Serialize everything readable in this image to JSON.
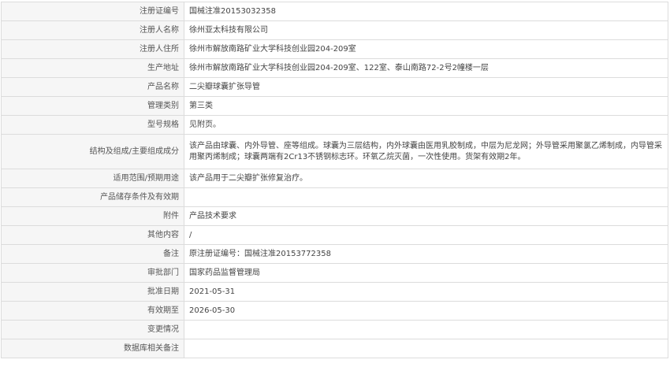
{
  "rows": [
    {
      "label": "注册证编号",
      "value": "国械注准20153032358"
    },
    {
      "label": "注册人名称",
      "value": "徐州亚太科技有限公司"
    },
    {
      "label": "注册人住所",
      "value": "徐州市解放南路矿业大学科技创业园204-209室"
    },
    {
      "label": "生产地址",
      "value": "徐州市解放南路矿业大学科技创业园204-209室、122室、泰山南路72-2号2幢楼一层"
    },
    {
      "label": "产品名称",
      "value": "二尖瓣球囊扩张导管"
    },
    {
      "label": "管理类别",
      "value": "第三类"
    },
    {
      "label": "型号规格",
      "value": "见附页。"
    },
    {
      "label": "结构及组成/主要组成成分",
      "value": "该产品由球囊、内外导管、座等组成。球囊为三层结构，内外球囊由医用乳胶制成，中层为尼龙网；外导管采用聚氯乙烯制成，内导管采用聚丙烯制成；球囊两端有2Cr13不锈钢标志环。环氧乙烷灭菌，一次性使用。货架有效期2年。"
    },
    {
      "label": "适用范围/预期用途",
      "value": "该产品用于二尖瓣扩张修复治疗。"
    },
    {
      "label": "产品储存条件及有效期",
      "value": ""
    },
    {
      "label": "附件",
      "value": "产品技术要求"
    },
    {
      "label": "其他内容",
      "value": "/"
    },
    {
      "label": "备注",
      "value": "原注册证编号：国械注准20153772358"
    },
    {
      "label": "审批部门",
      "value": "国家药品监督管理局"
    },
    {
      "label": "批准日期",
      "value": "2021-05-31"
    },
    {
      "label": "有效期至",
      "value": "2026-05-30"
    },
    {
      "label": "变更情况",
      "value": ""
    },
    {
      "label": "数据库相关备注",
      "value": ""
    }
  ]
}
